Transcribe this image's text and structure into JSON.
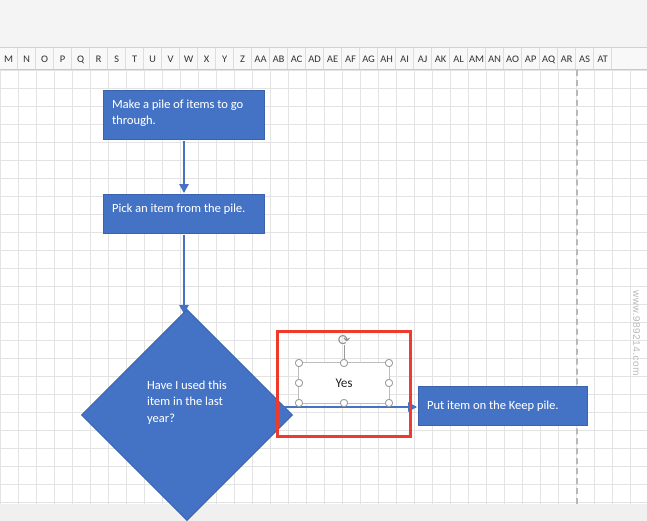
{
  "columns": [
    "M",
    "N",
    "O",
    "P",
    "Q",
    "R",
    "S",
    "T",
    "U",
    "V",
    "W",
    "X",
    "Y",
    "Z",
    "AA",
    "AB",
    "AC",
    "AD",
    "AE",
    "AF",
    "AG",
    "AH",
    "AI",
    "AJ",
    "AK",
    "AL",
    "AM",
    "AN",
    "AO",
    "AP",
    "AQ",
    "AR",
    "AS",
    "AT"
  ],
  "shapes": {
    "process1": "Make a pile of items to go through.",
    "process2": "Pick an item from the pile.",
    "decision": "Have I used this item in the last year?",
    "process3": "Put item on the Keep pile.",
    "textbox": "Yes"
  },
  "watermark": "www.989214.com",
  "rotate_glyph": "⟳",
  "chart_data": {
    "type": "flowchart",
    "nodes": [
      {
        "id": "n1",
        "type": "process",
        "text": "Make a pile of items to go through."
      },
      {
        "id": "n2",
        "type": "process",
        "text": "Pick an item from the pile."
      },
      {
        "id": "n3",
        "type": "decision",
        "text": "Have I used this item in the last year?"
      },
      {
        "id": "n4",
        "type": "process",
        "text": "Put item on the Keep pile."
      }
    ],
    "edges": [
      {
        "from": "n1",
        "to": "n2",
        "label": ""
      },
      {
        "from": "n2",
        "to": "n3",
        "label": ""
      },
      {
        "from": "n3",
        "to": "n4",
        "label": "Yes"
      }
    ]
  }
}
